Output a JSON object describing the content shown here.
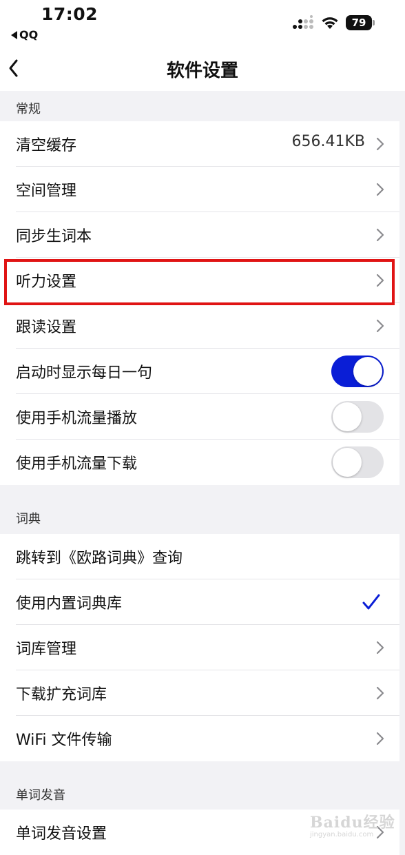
{
  "status_bar": {
    "time": "17:02",
    "back_app": "QQ",
    "battery": "79",
    "icons": [
      "cellular-signal-icon",
      "wifi-icon",
      "battery-icon"
    ]
  },
  "nav": {
    "title": "软件设置",
    "back_icon": "chevron-left-icon"
  },
  "sections": {
    "general": {
      "header": "常规",
      "clear_cache": {
        "label": "清空缓存",
        "value": "656.41KB"
      },
      "space_manage": {
        "label": "空间管理"
      },
      "sync_wordbook": {
        "label": "同步生词本"
      },
      "listening_settings": {
        "label": "听力设置"
      },
      "follow_read_settings": {
        "label": "跟读设置"
      },
      "show_daily_sentence": {
        "label": "启动时显示每日一句",
        "on": true
      },
      "mobile_data_play": {
        "label": "使用手机流量播放",
        "on": false
      },
      "mobile_data_download": {
        "label": "使用手机流量下载",
        "on": false
      }
    },
    "dictionary": {
      "header": "词典",
      "jump_eudic": {
        "label": "跳转到《欧路词典》查询"
      },
      "builtin_dict": {
        "label": "使用内置词典库",
        "checked": true
      },
      "dict_manage": {
        "label": "词库管理"
      },
      "download_dict": {
        "label": "下载扩充词库"
      },
      "wifi_transfer": {
        "label": "WiFi 文件传输"
      }
    },
    "pronunciation": {
      "header": "单词发音",
      "pronunciation_settings": {
        "label": "单词发音设置"
      }
    }
  },
  "colors": {
    "toggle_on": "#0a1ed6",
    "toggle_off": "#e3e3e6",
    "highlight": "#e01414",
    "check": "#0a1ed6",
    "background": "#f2f2f5"
  },
  "watermark": {
    "logo": "Baidu经验",
    "url": "jingyan.baidu.com"
  }
}
